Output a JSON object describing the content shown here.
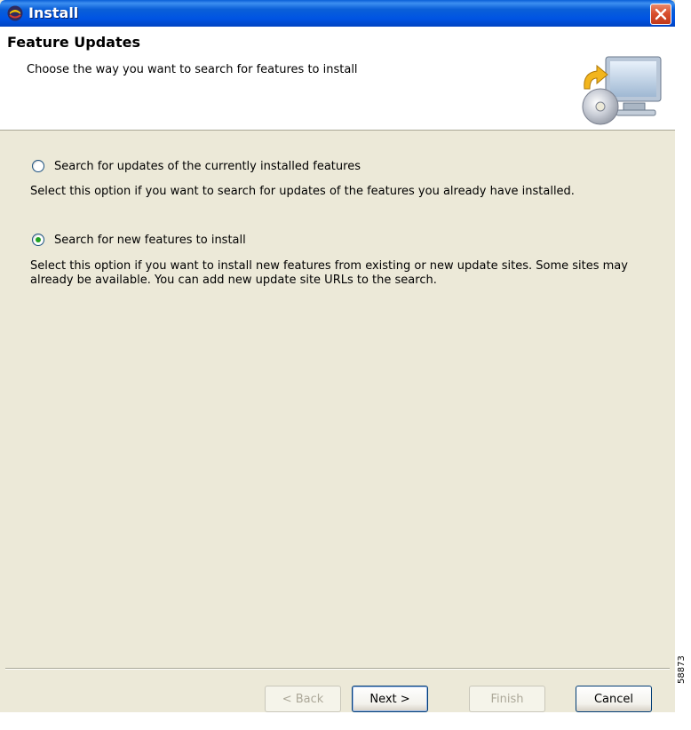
{
  "window": {
    "title": "Install",
    "close_icon": "close-icon",
    "app_icon": "eclipse-icon"
  },
  "header": {
    "title": "Feature Updates",
    "description": "Choose the way you want to search for features to install",
    "icon": "install-wizard-computer-icon"
  },
  "options": [
    {
      "label": "Search for updates of the currently installed features",
      "mnemonic": "u",
      "selected": false,
      "description": "Select this option if you want to search for updates of the features you already have installed."
    },
    {
      "label": "Search for new features to install",
      "mnemonic": "S",
      "selected": true,
      "description": "Select this option if you want to install new features from existing or new update sites. Some sites may already be available. You can add new update site URLs to the search."
    }
  ],
  "buttons": {
    "back": "< Back",
    "next": "Next >",
    "finish": "Finish",
    "cancel": "Cancel"
  },
  "figure_id": "58873",
  "colors": {
    "titlebar": "#0054e3",
    "dialog_bg": "#ece9d8",
    "close_button": "#d9502f",
    "radio_dot": "#21a121"
  }
}
